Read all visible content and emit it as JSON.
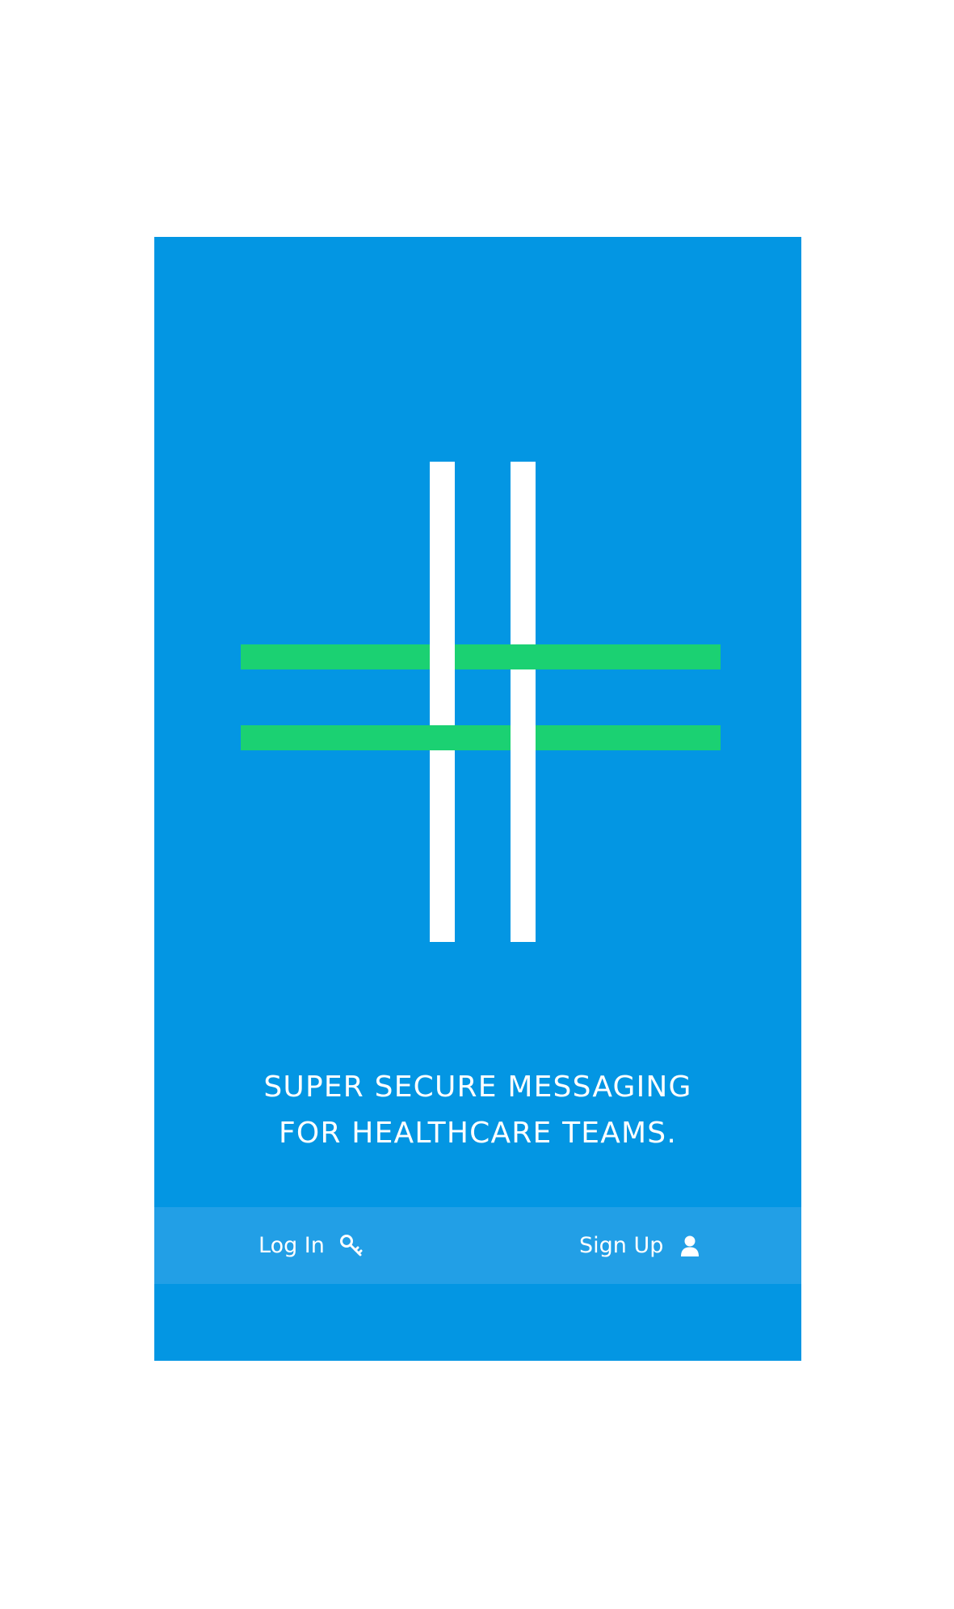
{
  "brand": {
    "background_color": "#0396e3",
    "vertical_bar_color": "#ffffff",
    "horizontal_bar_color": "#1bd172",
    "action_bar_color": "#229fe6"
  },
  "tagline": {
    "line1": "SUPER SECURE MESSAGING",
    "line2": "FOR HEALTHCARE TEAMS."
  },
  "actions": {
    "login": {
      "label": "Log In",
      "icon": "key-icon"
    },
    "signup": {
      "label": "Sign Up",
      "icon": "user-icon"
    }
  }
}
